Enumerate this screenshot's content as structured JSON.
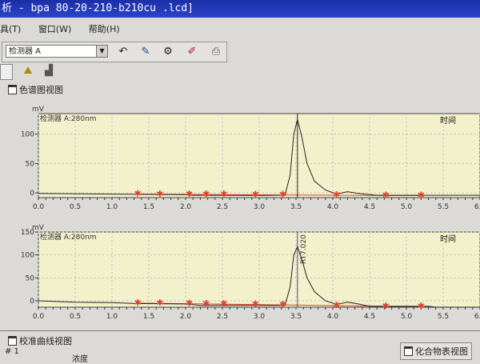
{
  "window": {
    "title": "析 - bpa 80-20-210-b210cu .lcd]"
  },
  "menu": [
    "具(T)",
    "窗口(W)",
    "帮助(H)"
  ],
  "toolbar": {
    "detector_select": "检测器 A",
    "icons": [
      "undo-icon",
      "peak-tool-icon",
      "integration-icon",
      "edit-icon",
      "report-icon"
    ]
  },
  "chromatogram_view": {
    "title": "色谱图视图"
  },
  "calibration_view": {
    "title": "校准曲线视图",
    "row_label": "# 1",
    "col_label": "浓度"
  },
  "compound_view": {
    "title": "化合物表视图"
  },
  "chart_data": [
    {
      "type": "line",
      "title": "检测器 A:280nm",
      "ylabel": "mV",
      "corner_label": "时间",
      "xlim": [
        0,
        6
      ],
      "ylim": [
        -8,
        135
      ],
      "xticks": [
        "0.0",
        "0.5",
        "1.0",
        "1.5",
        "2.0",
        "2.5",
        "3.0",
        "3.5",
        "4.0",
        "4.5",
        "5.0",
        "5.5",
        "6.0"
      ],
      "yticks": [
        "0",
        "50",
        "100"
      ],
      "trace": [
        [
          0,
          -1
        ],
        [
          1,
          -2
        ],
        [
          2,
          -3
        ],
        [
          2.1,
          -4
        ],
        [
          3,
          -4.5
        ],
        [
          3.35,
          -4
        ],
        [
          3.42,
          30
        ],
        [
          3.47,
          100
        ],
        [
          3.52,
          125
        ],
        [
          3.58,
          95
        ],
        [
          3.65,
          50
        ],
        [
          3.75,
          20
        ],
        [
          3.9,
          5
        ],
        [
          4.05,
          -2
        ],
        [
          4.2,
          2
        ],
        [
          4.35,
          -1
        ],
        [
          4.6,
          -4
        ],
        [
          6,
          -4
        ]
      ],
      "baseline": [
        [
          1.35,
          -2
        ],
        [
          4.72,
          -4.5
        ],
        [
          5.2,
          -4.5
        ]
      ],
      "markers": [
        1.35,
        1.65,
        2.05,
        2.28,
        2.52,
        2.95,
        3.32,
        4.05,
        4.72,
        5.2
      ],
      "retention_line": 3.52,
      "colors": {
        "trace": "#222222",
        "baseline": "#e0402a",
        "background": "#f3f0cc"
      }
    },
    {
      "type": "line",
      "title": "检测器 A:280nm",
      "ylabel": "mV",
      "corner_label": "时间",
      "xlim": [
        0,
        6
      ],
      "ylim": [
        -14,
        150
      ],
      "xticks": [
        "0.0",
        "0.5",
        "1.0",
        "1.5",
        "2.0",
        "2.5",
        "3.0",
        "3.5",
        "4.0",
        "4.5",
        "5.0",
        "5.5",
        "6.0"
      ],
      "yticks": [
        "0",
        "50",
        "100",
        "150"
      ],
      "trace": [
        [
          0,
          0
        ],
        [
          0.5,
          -3
        ],
        [
          1,
          -4
        ],
        [
          1.3,
          -6
        ],
        [
          2,
          -7
        ],
        [
          2.2,
          -10
        ],
        [
          3,
          -10
        ],
        [
          3.35,
          -10
        ],
        [
          3.42,
          30
        ],
        [
          3.47,
          100
        ],
        [
          3.52,
          118
        ],
        [
          3.58,
          90
        ],
        [
          3.65,
          50
        ],
        [
          3.75,
          20
        ],
        [
          3.9,
          0
        ],
        [
          4.05,
          -8
        ],
        [
          4.2,
          -3
        ],
        [
          4.35,
          -7
        ],
        [
          4.5,
          -12
        ],
        [
          5.3,
          -12
        ],
        [
          5.4,
          -14
        ],
        [
          6,
          -14
        ]
      ],
      "baseline": [
        [
          1.35,
          -5
        ],
        [
          4.72,
          -12
        ],
        [
          5.2,
          -12
        ]
      ],
      "markers": [
        1.35,
        1.65,
        2.05,
        2.28,
        2.52,
        2.95,
        3.32,
        4.05,
        4.72,
        5.2
      ],
      "retention_line": 3.52,
      "retention_label": "RT7.020",
      "colors": {
        "trace": "#222222",
        "baseline": "#e0402a",
        "background": "#f3f0cc"
      }
    }
  ]
}
